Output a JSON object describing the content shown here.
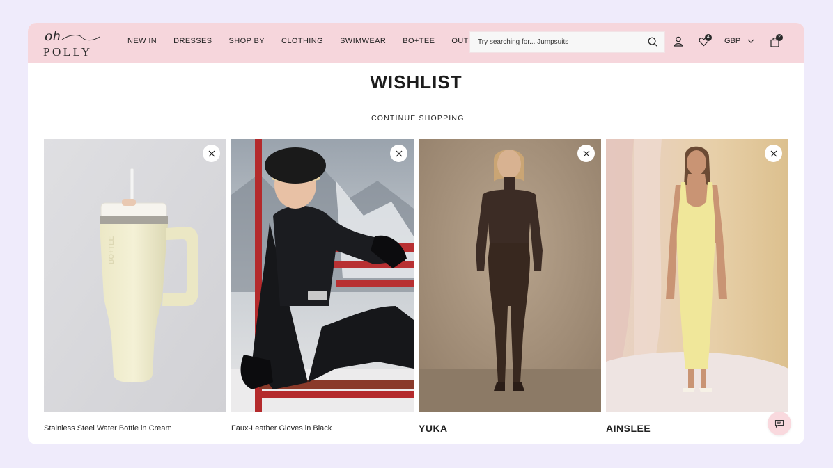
{
  "brand": {
    "logo_top": "oh",
    "logo_bottom": "POLLY"
  },
  "nav": [
    "NEW IN",
    "DRESSES",
    "SHOP BY",
    "CLOTHING",
    "SWIMWEAR",
    "BO+TEE",
    "OUTLET"
  ],
  "search": {
    "placeholder": "Try searching for... Jumpsuits"
  },
  "header": {
    "wishlist_count": "4",
    "bag_count": "2",
    "currency": "GBP"
  },
  "page": {
    "title": "WISHLIST",
    "continue_label": "CONTINUE SHOPPING"
  },
  "products": [
    {
      "name": "Stainless Steel Water Bottle in Cream",
      "bottle_text": "BO+TEE"
    },
    {
      "name": "Faux-Leather Gloves in Black"
    },
    {
      "name": "YUKA"
    },
    {
      "name": "AINSLEE"
    }
  ],
  "icons": {
    "search": "search-icon",
    "account": "user-icon",
    "wishlist": "heart-icon",
    "currency_dropdown": "chevron-down-icon",
    "bag": "bag-icon",
    "remove": "close-icon",
    "chat": "chat-icon"
  },
  "colors": {
    "page_bg": "#efebfb",
    "header_bg": "#f6d6dc",
    "chat_bg": "#f9d9de",
    "text": "#1c1c1c"
  }
}
